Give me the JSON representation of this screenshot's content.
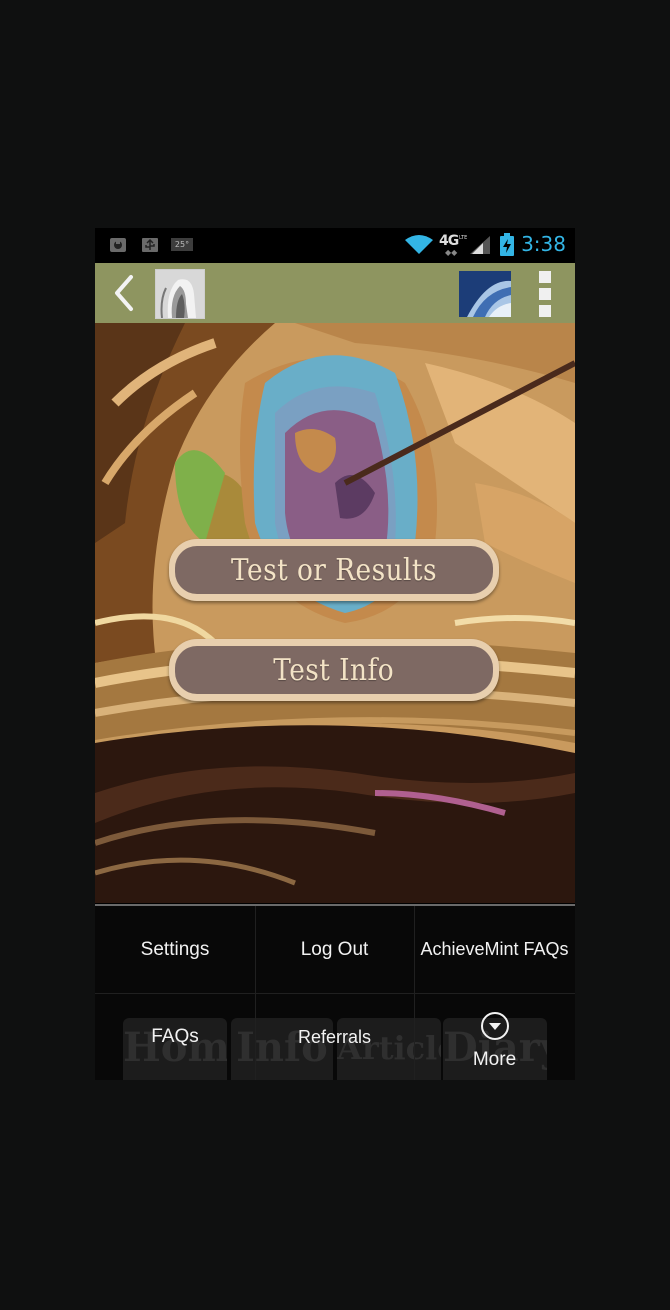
{
  "status_bar": {
    "time": "3:38",
    "network": "4G",
    "lte": "LTE",
    "notification_badge": "25°",
    "icons": [
      "android-debug-icon",
      "usb-icon",
      "temperature-notification-icon",
      "wifi-icon",
      "network-4g-icon",
      "signal-icon",
      "battery-charging-icon"
    ],
    "accent_color": "#33b5e5"
  },
  "action_bar": {
    "background_color": "#8e9560",
    "icons": [
      "back-arrow-icon",
      "avatar",
      "app-logo",
      "overflow-menu-icon"
    ]
  },
  "main": {
    "buttons": [
      {
        "label": "Test or Results"
      },
      {
        "label": "Test Info"
      }
    ]
  },
  "bottom_tabs": {
    "tabs": [
      "Home",
      "Info",
      "Articles",
      "Diary"
    ]
  },
  "overflow_menu": {
    "items": [
      {
        "label": "Settings"
      },
      {
        "label": "Log Out"
      },
      {
        "label": "AchieveMint FAQs"
      },
      {
        "label": "FAQs"
      },
      {
        "label": "Referrals"
      },
      {
        "label": "More",
        "icon": "chevron-down-circle-icon"
      }
    ]
  }
}
